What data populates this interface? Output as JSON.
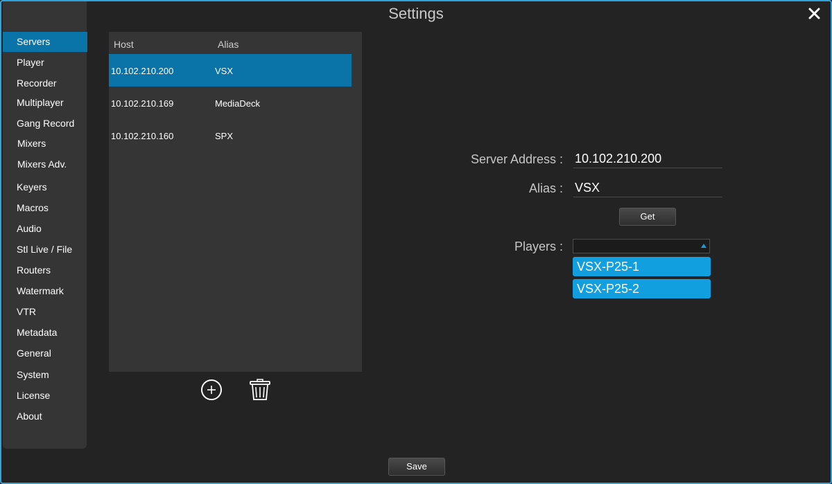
{
  "window": {
    "title": "Settings",
    "accent_color": "#2fa3dc",
    "selection_color": "#0a73a8"
  },
  "sidebar": {
    "items": [
      {
        "label": "Servers",
        "active": true
      },
      {
        "label": "Player"
      },
      {
        "label": "Recorder"
      },
      {
        "label": "Multiplayer"
      },
      {
        "label": "Gang Record"
      },
      {
        "label": "Mixers"
      },
      {
        "label": "Mixers Adv."
      },
      {
        "label": "Keyers"
      },
      {
        "label": "Macros"
      },
      {
        "label": "Audio"
      },
      {
        "label": "Stl Live / File"
      },
      {
        "label": "Routers"
      },
      {
        "label": "Watermark"
      },
      {
        "label": "VTR"
      },
      {
        "label": "Metadata"
      },
      {
        "label": "General"
      },
      {
        "label": "System"
      },
      {
        "label": "License"
      },
      {
        "label": "About"
      }
    ]
  },
  "servers": {
    "columns": {
      "host": "Host",
      "alias": "Alias"
    },
    "rows": [
      {
        "host": "10.102.210.200",
        "alias": "VSX",
        "selected": true
      },
      {
        "host": "10.102.210.169",
        "alias": "MediaDeck"
      },
      {
        "host": "10.102.210.160",
        "alias": "SPX"
      }
    ],
    "add_icon": "plus-circle-icon",
    "delete_icon": "trash-icon"
  },
  "details": {
    "server_address_label": "Server Address :",
    "server_address_value": "10.102.210.200",
    "alias_label": "Alias  :",
    "alias_value": "VSX",
    "get_button": "Get",
    "players_label": "Players :",
    "players_selected": "",
    "players": [
      "VSX-P25-1",
      "VSX-P25-2"
    ]
  },
  "footer": {
    "save_button": "Save"
  }
}
